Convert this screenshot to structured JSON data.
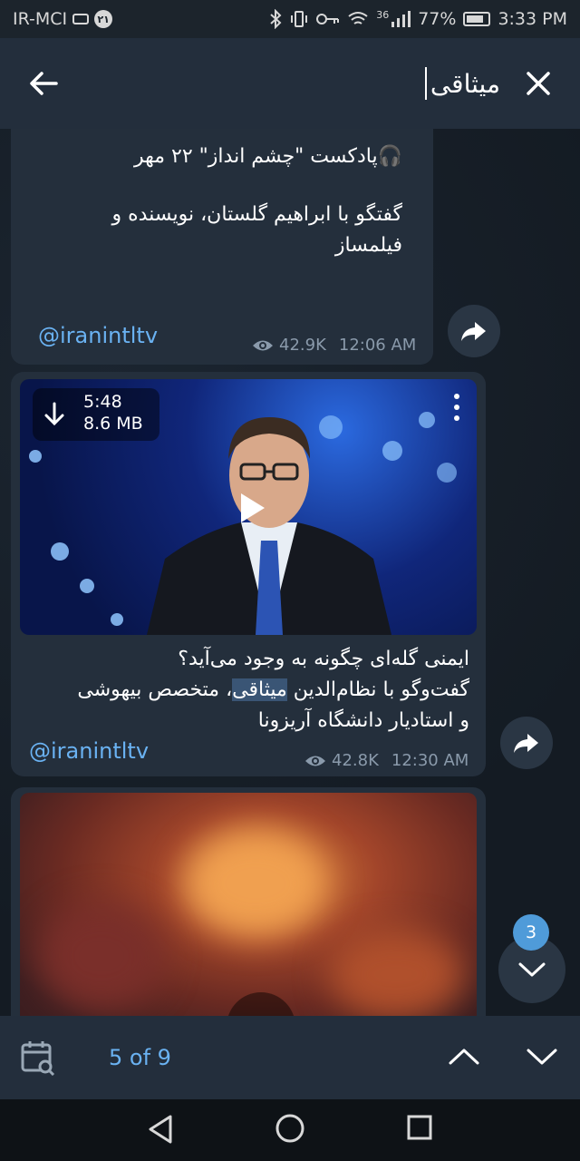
{
  "status_bar": {
    "carrier": "IR-MCI",
    "sim_badge": "۲۱",
    "network": "36",
    "battery": "77%",
    "time": "3:33 PM"
  },
  "search": {
    "query": "میثاقی",
    "back_icon": "arrow-left-icon",
    "close_icon": "close-icon"
  },
  "messages": [
    {
      "lines": [
        "🎧پادکست \"چشم انداز\" ۲۲ مهر",
        "گفتگو با ابراهیم گلستان، نویسنده و فیلمساز"
      ],
      "handle": "@iranintltv",
      "views": "42.9K",
      "time": "12:06 AM"
    },
    {
      "video": {
        "duration": "5:48",
        "size": "8.6 MB"
      },
      "line1": "ایمنی گله‌ای چگونه به وجود می‌آید؟",
      "line2_before": "گفت‌وگو با نظام‌الدین ",
      "line2_highlight": "میثاقی",
      "line2_after": "، متخصص بیهوشی",
      "line3": "و استادیار دانشگاه آریزونا",
      "handle": "@iranintltv",
      "views": "42.8K",
      "time": "12:30 AM"
    }
  ],
  "unread_count": "3",
  "search_nav": {
    "counter": "5 of 9"
  },
  "colors": {
    "accent": "#6ab2f2",
    "badge": "#4f9bd9",
    "header": "#232e3c",
    "bubble": "#242f3c"
  }
}
